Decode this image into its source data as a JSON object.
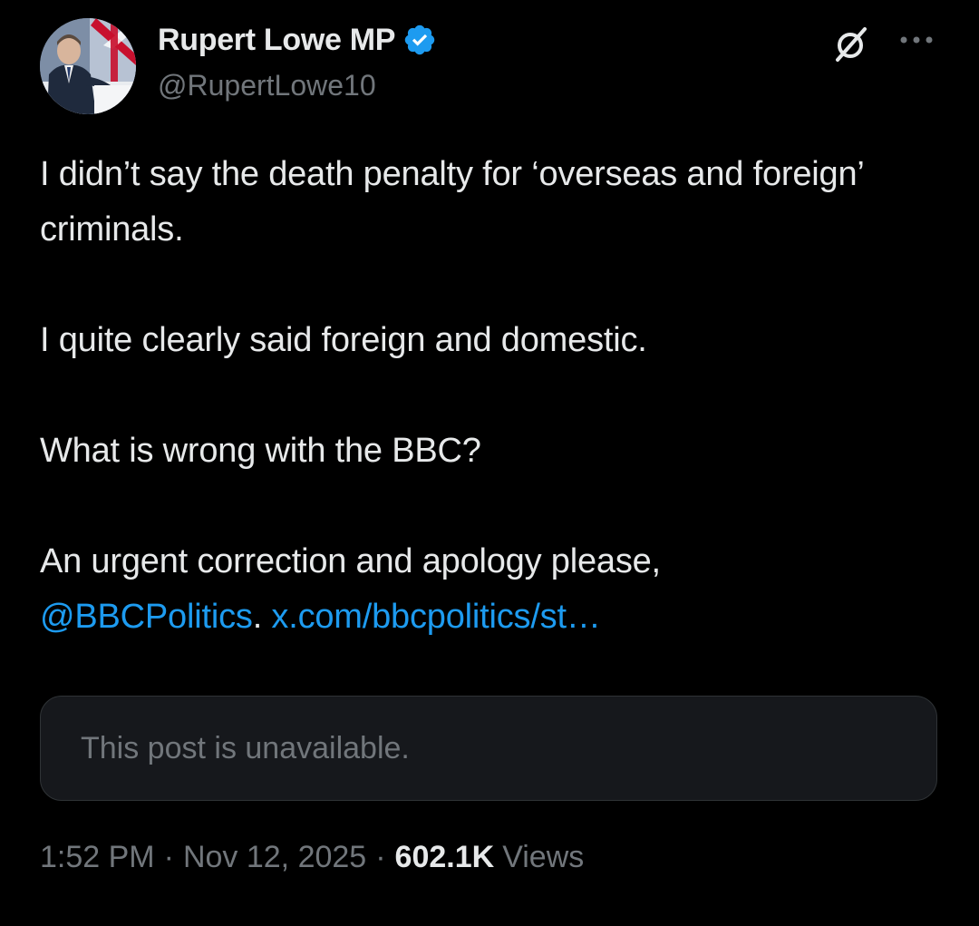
{
  "author": {
    "display_name": "Rupert Lowe MP",
    "handle": "@RupertLowe10",
    "verified": true,
    "verified_color": "#1d9bf0"
  },
  "icons": {
    "avatar": "avatar-photo",
    "verified": "verified-badge-icon",
    "grok": "grok-icon",
    "more": "more-options-icon"
  },
  "post": {
    "paragraphs": [
      "I didn’t say the death penalty for ‘overseas and foreign’ criminals.",
      "I quite clearly said foreign and domestic.",
      "What is wrong with the BBC?",
      "An urgent correction and apology please,"
    ],
    "mention": "@BBCPolitics",
    "after_mention": ".",
    "link_text": "x.com/bbcpolitics/st…",
    "link_color": "#1d9bf0"
  },
  "quoted_post": {
    "text": "This post is unavailable."
  },
  "meta": {
    "time": "1:52 PM",
    "separator": "·",
    "date": "Nov 12, 2025",
    "views_count": "602.1K",
    "views_label": "Views"
  },
  "colors": {
    "background": "#000000",
    "text_primary": "#e7e9ea",
    "text_secondary": "#71767b",
    "card_background": "#16181c",
    "card_border": "#2f3336"
  }
}
